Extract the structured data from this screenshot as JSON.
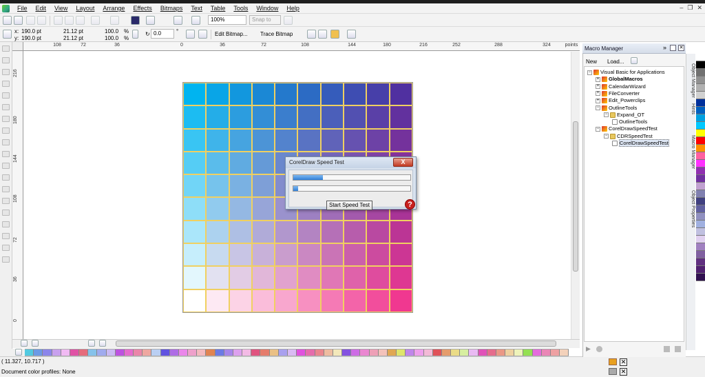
{
  "menu": [
    "File",
    "Edit",
    "View",
    "Layout",
    "Arrange",
    "Effects",
    "Bitmaps",
    "Text",
    "Table",
    "Tools",
    "Window",
    "Help"
  ],
  "toolbar": {
    "zoom": "100%",
    "snap_to": "Snap to",
    "x_value": "190.0 pt",
    "y_value": "190.0 pt",
    "w_value": "21.12 pt",
    "h_value": "21.12 pt",
    "scale_x": "100.0",
    "scale_y": "100.0",
    "scale_unit_x": "%",
    "scale_unit_y": "%",
    "angle": "0.0",
    "angle_unit": "°",
    "edit_bitmap": "Edit Bitmap...",
    "trace_bitmap": "Trace Bitmap",
    "x_label": "x:",
    "y_label": "y:"
  },
  "ruler": {
    "units": "points",
    "h_ticks": [
      "108",
      "72",
      "36",
      "0",
      "36",
      "72",
      "108",
      "144",
      "180",
      "216",
      "252",
      "288",
      "324"
    ],
    "v_ticks": [
      "216",
      "180",
      "144",
      "108",
      "72",
      "36",
      "0"
    ]
  },
  "dialog": {
    "title": "CorelDraw Speed Test",
    "close": "X",
    "progress1": 0.25,
    "progress2": 0.04,
    "start_button": "Start Speed Test",
    "help": "?"
  },
  "macro_manager": {
    "title": "Macro Manager",
    "new_label": "New",
    "load_label": "Load...",
    "tree": [
      {
        "label": "Visual Basic for Applications",
        "level": 0,
        "icon": "vba-icon",
        "bold": false
      },
      {
        "label": "GlobalMacros",
        "level": 1,
        "icon": "module-icon",
        "bold": true
      },
      {
        "label": "CalendarWizard",
        "level": 1,
        "icon": "module-icon",
        "bold": false
      },
      {
        "label": "FileConverter",
        "level": 1,
        "icon": "module-icon",
        "bold": false
      },
      {
        "label": "Edit_Powerclips",
        "level": 1,
        "icon": "module-icon",
        "bold": false
      },
      {
        "label": "OutlineTools",
        "level": 1,
        "icon": "module-icon",
        "bold": false
      },
      {
        "label": "Expand_OT",
        "level": 2,
        "icon": "folder-icon",
        "bold": false
      },
      {
        "label": "OutlineTools",
        "level": 3,
        "icon": "macro-icon",
        "bold": false
      },
      {
        "label": "CorelDrawSpeedTest",
        "level": 1,
        "icon": "module-icon",
        "bold": false
      },
      {
        "label": "CDRSpeedTest",
        "level": 2,
        "icon": "folder-icon",
        "bold": false
      },
      {
        "label": "CorelDrawSpeedTest",
        "level": 3,
        "icon": "macro-icon",
        "bold": false
      }
    ]
  },
  "docker_tabs": [
    "Object Manager",
    "Hints",
    "Macro Manager",
    "Object Properties"
  ],
  "status": {
    "coords": "( 11.327, 10.717 )",
    "profiles": "Document color profiles: None"
  },
  "colors": {
    "grid_top_left": "#00b4f0",
    "grid_top_right": "#5030a0",
    "grid_bottom_left": "#ffffff",
    "grid_bottom_right": "#f03890",
    "cell_border": "#f0d060"
  },
  "palette": [
    "#ffffff",
    "#000000",
    "#707070",
    "#909090",
    "#b0b0b0",
    "#d0d0d0",
    "#00309c",
    "#0060c0",
    "#00a0e0",
    "#00c8ff",
    "#ffff00",
    "#ff0000",
    "#ff9000",
    "#ff60a0",
    "#ff30ff",
    "#9030b0",
    "#7030a0",
    "#c0a0d0",
    "#8080b0",
    "#404080",
    "#6060a0",
    "#9090c0",
    "#a0b0e0",
    "#c0c0e0",
    "#e0d0f0",
    "#a080c0",
    "#8060a0",
    "#603080",
    "#502070",
    "#301050"
  ]
}
